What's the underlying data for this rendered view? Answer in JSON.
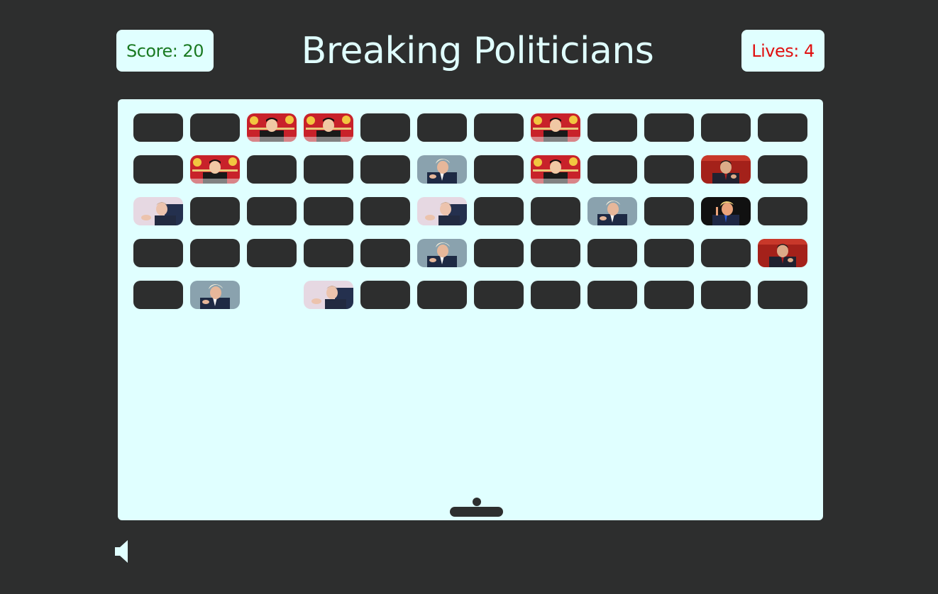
{
  "header": {
    "title": "Breaking Politicians",
    "score_text": "Score: 20",
    "lives_text": "Lives: 4"
  },
  "colors": {
    "background": "#2d2e2e",
    "board": "#e0ffff",
    "score": "#1a7a22",
    "lives": "#e01010",
    "brick": "#2d2e2e"
  },
  "controls": {
    "sound_icon": "speaker-icon"
  },
  "bricks": {
    "columns": 12,
    "rows": [
      [
        "empty",
        "empty",
        "kim",
        "kim",
        "empty",
        "empty",
        "empty",
        "kim",
        "empty",
        "empty",
        "empty",
        "empty"
      ],
      [
        "empty",
        "kim",
        "empty",
        "empty",
        "empty",
        "boris",
        "empty",
        "kim",
        "empty",
        "empty",
        "xi",
        "empty"
      ],
      [
        "putin",
        "empty",
        "empty",
        "empty",
        "empty",
        "putin",
        "empty",
        "empty",
        "boris",
        "empty",
        "trump",
        "empty"
      ],
      [
        "empty",
        "empty",
        "empty",
        "empty",
        "empty",
        "boris",
        "empty",
        "empty",
        "empty",
        "empty",
        "empty",
        "xi"
      ],
      [
        "empty",
        "boris",
        "none",
        "putin",
        "empty",
        "empty",
        "empty",
        "empty",
        "empty",
        "empty",
        "empty",
        "empty"
      ]
    ]
  }
}
